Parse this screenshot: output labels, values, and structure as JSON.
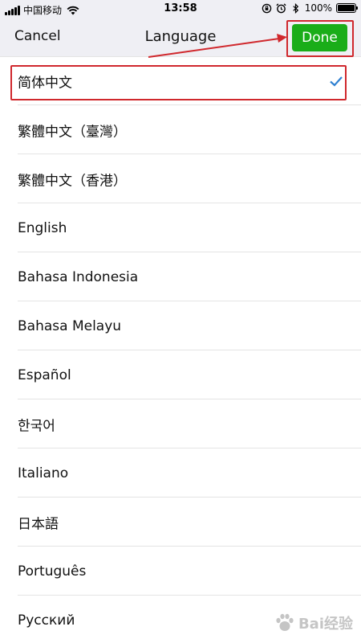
{
  "status_bar": {
    "carrier": "中国移动",
    "time": "13:58",
    "battery_percent_label": "100%",
    "battery_level": 1.0
  },
  "nav": {
    "cancel_label": "Cancel",
    "title": "Language",
    "done_label": "Done"
  },
  "colors": {
    "done_button": "#1aad19",
    "checkmark": "#2f80d1",
    "annotation": "#d0282d",
    "bar_background": "#efeff4"
  },
  "languages": [
    {
      "label": "简体中文",
      "selected": true
    },
    {
      "label": "繁體中文（臺灣）",
      "selected": false
    },
    {
      "label": "繁體中文（香港）",
      "selected": false
    },
    {
      "label": "English",
      "selected": false
    },
    {
      "label": "Bahasa Indonesia",
      "selected": false
    },
    {
      "label": "Bahasa Melayu",
      "selected": false
    },
    {
      "label": "Español",
      "selected": false
    },
    {
      "label": "한국어",
      "selected": false
    },
    {
      "label": "Italiano",
      "selected": false
    },
    {
      "label": "日本語",
      "selected": false
    },
    {
      "label": "Português",
      "selected": false
    },
    {
      "label": "Русский",
      "selected": false
    }
  ],
  "watermark": {
    "text": "Bai经验",
    "icon": "baidu-paw-icon"
  }
}
